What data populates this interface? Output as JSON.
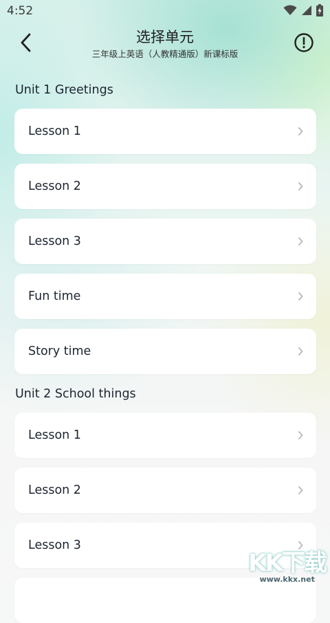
{
  "status_bar": {
    "time": "4:52"
  },
  "header": {
    "title": "选择单元",
    "subtitle": "三年级上英语（人教精通版）新课标版"
  },
  "units": [
    {
      "title": "Unit 1 Greetings",
      "lessons": [
        "Lesson 1",
        "Lesson 2",
        "Lesson 3",
        "Fun time",
        "Story time"
      ]
    },
    {
      "title": "Unit 2 School things",
      "lessons": [
        "Lesson 1",
        "Lesson 2",
        "Lesson 3"
      ]
    }
  ],
  "watermark": {
    "logo_text": "KK下载",
    "site": "www.kkx.net"
  },
  "colors": {
    "card_bg": "#ffffff",
    "text_primary": "#1c2430",
    "chevron": "#b5b8bd"
  },
  "icons": {
    "back": "back-arrow-icon",
    "info": "info-circle-icon",
    "chevron": "chevron-right-icon",
    "wifi": "wifi-icon",
    "signal": "signal-icon",
    "battery": "battery-charging-icon"
  }
}
